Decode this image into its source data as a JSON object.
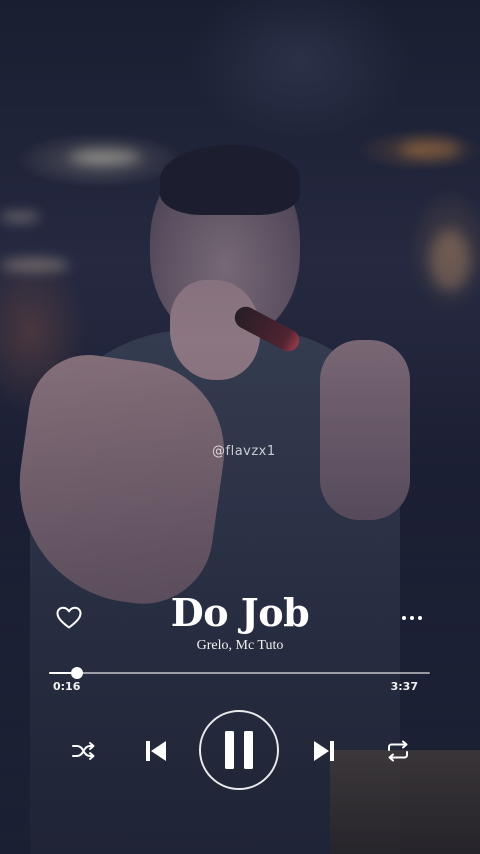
{
  "watermark": "@flavzx1",
  "track": {
    "title": "Do Job",
    "artists": "Grelo, Mc Tuto"
  },
  "progress": {
    "elapsed": "0:16",
    "total": "3:37",
    "fraction": 0.074
  },
  "icons": {
    "like": "heart-outline-icon",
    "more": "more-horizontal-icon",
    "shuffle": "shuffle-icon",
    "previous": "skip-previous-icon",
    "play_pause": "pause-icon",
    "next": "skip-next-icon",
    "repeat": "repeat-icon"
  },
  "colors": {
    "foreground": "#ffffff",
    "track": "#ffffff8c"
  }
}
